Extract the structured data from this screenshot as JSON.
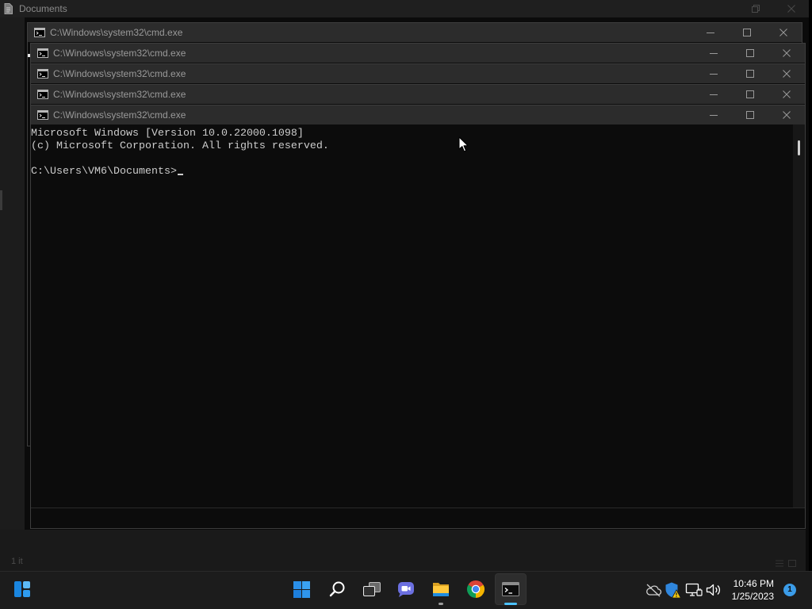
{
  "background_window": {
    "title": "Documents",
    "status_text": "1 it",
    "icon": "document-icon"
  },
  "cmd_windows": [
    {
      "title": "C:\\Windows\\system32\\cmd.exe",
      "icon": "cmd-icon",
      "active": false
    },
    {
      "title": "C:\\Windows\\system32\\cmd.exe",
      "icon": "cmd-icon",
      "active": false
    },
    {
      "title": "C:\\Windows\\system32\\cmd.exe",
      "icon": "cmd-icon",
      "active": false
    },
    {
      "title": "C:\\Windows\\system32\\cmd.exe",
      "icon": "cmd-icon",
      "active": false
    },
    {
      "title": "C:\\Windows\\system32\\cmd.exe",
      "icon": "cmd-icon",
      "active": true
    }
  ],
  "caption_buttons": [
    "minimize-icon",
    "maximize-icon",
    "close-icon"
  ],
  "console": {
    "lines": [
      "Microsoft Windows [Version 10.0.22000.1098]",
      "(c) Microsoft Corporation. All rights reserved.",
      "",
      "C:\\Users\\VM6\\Documents>"
    ]
  },
  "taskbar": {
    "widgets": {
      "icon": "widgets-icon"
    },
    "pinned": [
      {
        "icon": "start-icon"
      },
      {
        "icon": "search-icon"
      },
      {
        "icon": "task-view-icon"
      },
      {
        "icon": "chat-icon"
      },
      {
        "icon": "file-explorer-icon",
        "running": true
      },
      {
        "icon": "chrome-icon"
      },
      {
        "icon": "terminal-icon",
        "active": true
      }
    ],
    "tray": [
      {
        "icon": "onedrive-offline-icon"
      },
      {
        "icon": "windows-security-warning-icon"
      },
      {
        "icon": "network-icon"
      },
      {
        "icon": "volume-icon"
      }
    ],
    "clock": {
      "time": "10:46 PM",
      "date": "1/25/2023"
    },
    "notification_count": "1"
  },
  "colors": {
    "accent": "#4cc2ff",
    "console_bg": "#0c0c0c",
    "console_text": "#cccccc",
    "title_bar": "#2c2c2c",
    "taskbar_bg": "#1c1c1c"
  }
}
